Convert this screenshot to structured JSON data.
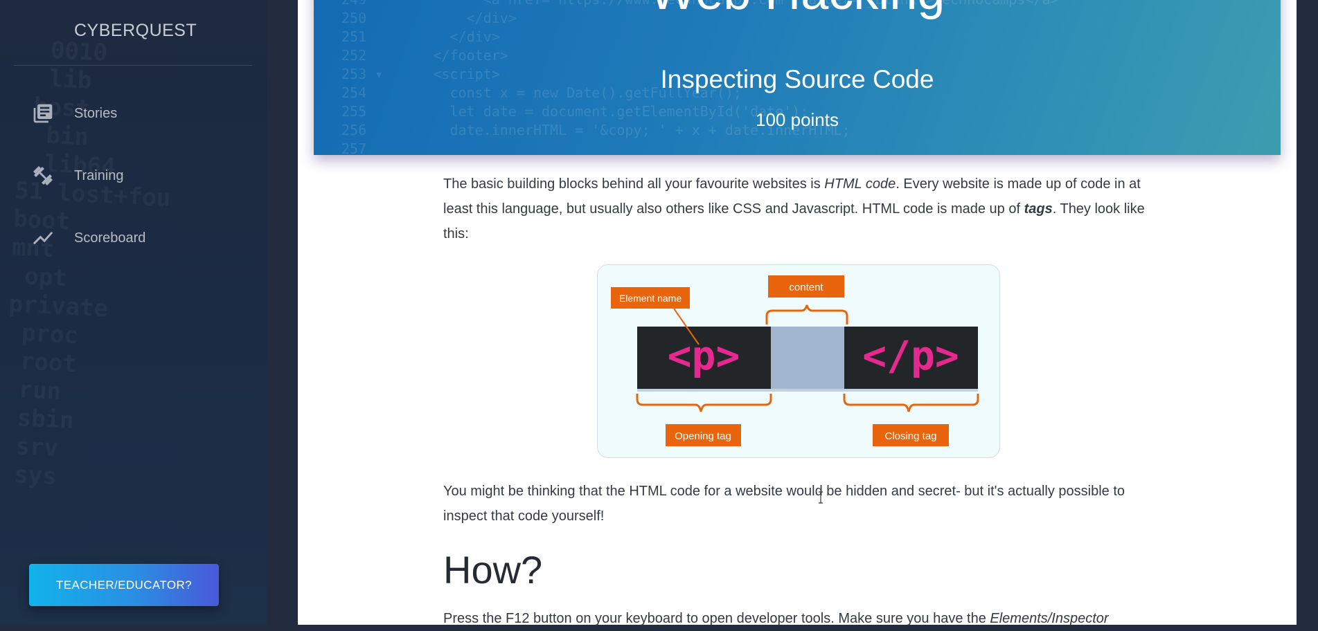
{
  "sidebar": {
    "brand": "CYBERQUEST",
    "items": [
      {
        "label": "Stories",
        "icon": "book-stack-icon"
      },
      {
        "label": "Training",
        "icon": "dumbbell-icon"
      },
      {
        "label": "Scoreboard",
        "icon": "trend-line-icon"
      }
    ],
    "teacher_button": "TEACHER/EDUCATOR?"
  },
  "hero": {
    "title": "Web Hacking",
    "subtitle": "Inspecting Source Code",
    "points": "100 points"
  },
  "content": {
    "para1_a": "The basic building blocks behind all your favourite websites is ",
    "para1_em": "HTML code",
    "para1_b": ". Every website is made up of code in at least this language, but usually also others like CSS and Javascript. HTML code is made up of ",
    "para1_em2": "tags",
    "para1_c": ". They look like this:",
    "figure": {
      "element_name": "Element name",
      "content": "content",
      "open_tag": "<p>",
      "close_tag": "</p>",
      "opening_label": "Opening tag",
      "closing_label": "Closing tag"
    },
    "para2": "You might be thinking that the HTML code for a website would be hidden and secret- but it's actually possible to inspect that code yourself!",
    "heading": "How?",
    "para3_a": "Press the F12 button on your keyboard to open developer tools. Make sure you have the ",
    "para3_em": "Elements/Inspector"
  },
  "colors": {
    "accent_orange": "#e8650d",
    "tag_pink": "#e5298f",
    "hero_blue": "#1f7ab9"
  }
}
